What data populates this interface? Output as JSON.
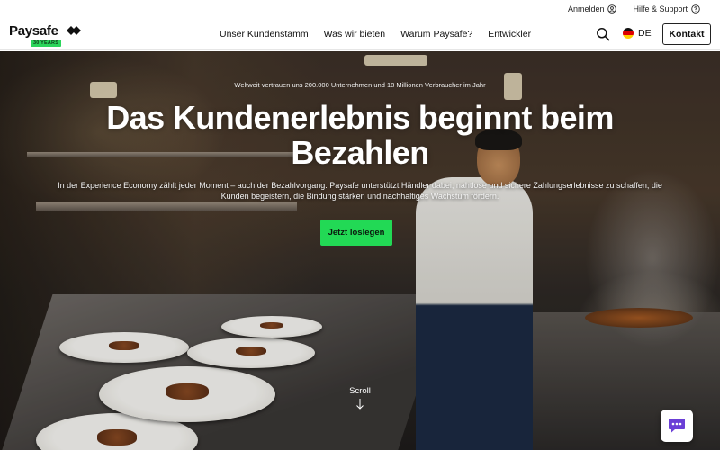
{
  "utility": {
    "login_label": "Anmelden",
    "help_label": "Hilfe & Support"
  },
  "header": {
    "logo_text": "Paysafe",
    "logo_badge": "30 YEARS",
    "nav": [
      {
        "label": "Unser Kundenstamm"
      },
      {
        "label": "Was wir bieten"
      },
      {
        "label": "Warum Paysafe?"
      },
      {
        "label": "Entwickler"
      }
    ],
    "language": "DE",
    "contact_label": "Kontakt"
  },
  "hero": {
    "eyebrow": "Weltweit vertrauen uns 200.000 Unternehmen und 18 Millionen Verbraucher im Jahr",
    "title": "Das Kundenerlebnis beginnt beim Bezahlen",
    "description": "In der Experience Economy zählt jeder Moment – auch der Bezahlvorgang. Paysafe unterstützt Händler dabei, nahtlose und sichere Zahlungserlebnisse zu schaffen, die Kunden begeistern, die Bindung stärken und nachhaltiges Wachstum fördern.",
    "cta_label": "Jetzt loslegen",
    "scroll_label": "Scroll"
  },
  "icons": {
    "user": "user-circle-icon",
    "help": "help-circle-icon",
    "search": "search-icon",
    "flag": "germany-flag-icon",
    "chat": "chat-icon",
    "scroll": "arrow-down-icon"
  },
  "colors": {
    "brand_green": "#22d955",
    "chat_purple": "#6b3fd6"
  }
}
